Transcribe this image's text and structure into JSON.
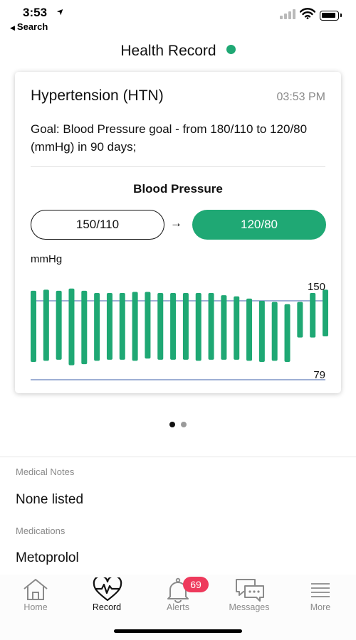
{
  "status_bar": {
    "time": "3:53",
    "back_label": "Search"
  },
  "header": {
    "title": "Health Record",
    "status_color": "#1fa874"
  },
  "card": {
    "title": "Hypertension (HTN)",
    "time": "03:53 PM",
    "goal_text": "Goal: Blood Pressure goal - from 180/110 to 120/80 (mmHg) in 90 days;",
    "section_title": "Blood Pressure",
    "current_value": "150/110",
    "arrow": "→",
    "goal_value": "120/80",
    "unit": "mmHg"
  },
  "chart_data": {
    "type": "bar",
    "ylabel": "mmHg",
    "reference_lines": [
      {
        "label": "150",
        "value": 150
      },
      {
        "label": "79",
        "value": 79
      }
    ],
    "ylim": [
      65,
      170
    ],
    "bar_color": "#1fa874",
    "ref_line_color": "#3d5fa8",
    "series": [
      {
        "ranges": [
          [
            159,
            95
          ],
          [
            160,
            96
          ],
          [
            159,
            97
          ],
          [
            161,
            92
          ],
          [
            159,
            93
          ],
          [
            157,
            96
          ],
          [
            157,
            97
          ],
          [
            157,
            97
          ],
          [
            158,
            96
          ],
          [
            158,
            98
          ],
          [
            157,
            97
          ],
          [
            157,
            97
          ],
          [
            157,
            97
          ],
          [
            157,
            96
          ],
          [
            157,
            97
          ],
          [
            155,
            97
          ],
          [
            154,
            97
          ],
          [
            152,
            96
          ],
          [
            150,
            95
          ],
          [
            149,
            96
          ],
          [
            147,
            95
          ],
          [
            149,
            117
          ],
          [
            157,
            117
          ],
          [
            160,
            118
          ]
        ]
      }
    ]
  },
  "pager": {
    "pages": 2,
    "active": 0
  },
  "sections": {
    "medical_notes_label": "Medical Notes",
    "medical_notes_value": "None listed",
    "medications_label": "Medications",
    "medications_value": "Metoprolol"
  },
  "tab_bar": {
    "accent": "#111111",
    "inactive": "#8a8a8a",
    "badge_color": "#ee3a5c",
    "tabs": [
      {
        "label": "Home",
        "icon": "home-icon"
      },
      {
        "label": "Record",
        "icon": "heart-pulse-icon"
      },
      {
        "label": "Alerts",
        "icon": "bell-icon",
        "badge": "69"
      },
      {
        "label": "Messages",
        "icon": "chat-bubbles-icon"
      },
      {
        "label": "More",
        "icon": "hamburger-icon"
      }
    ]
  }
}
